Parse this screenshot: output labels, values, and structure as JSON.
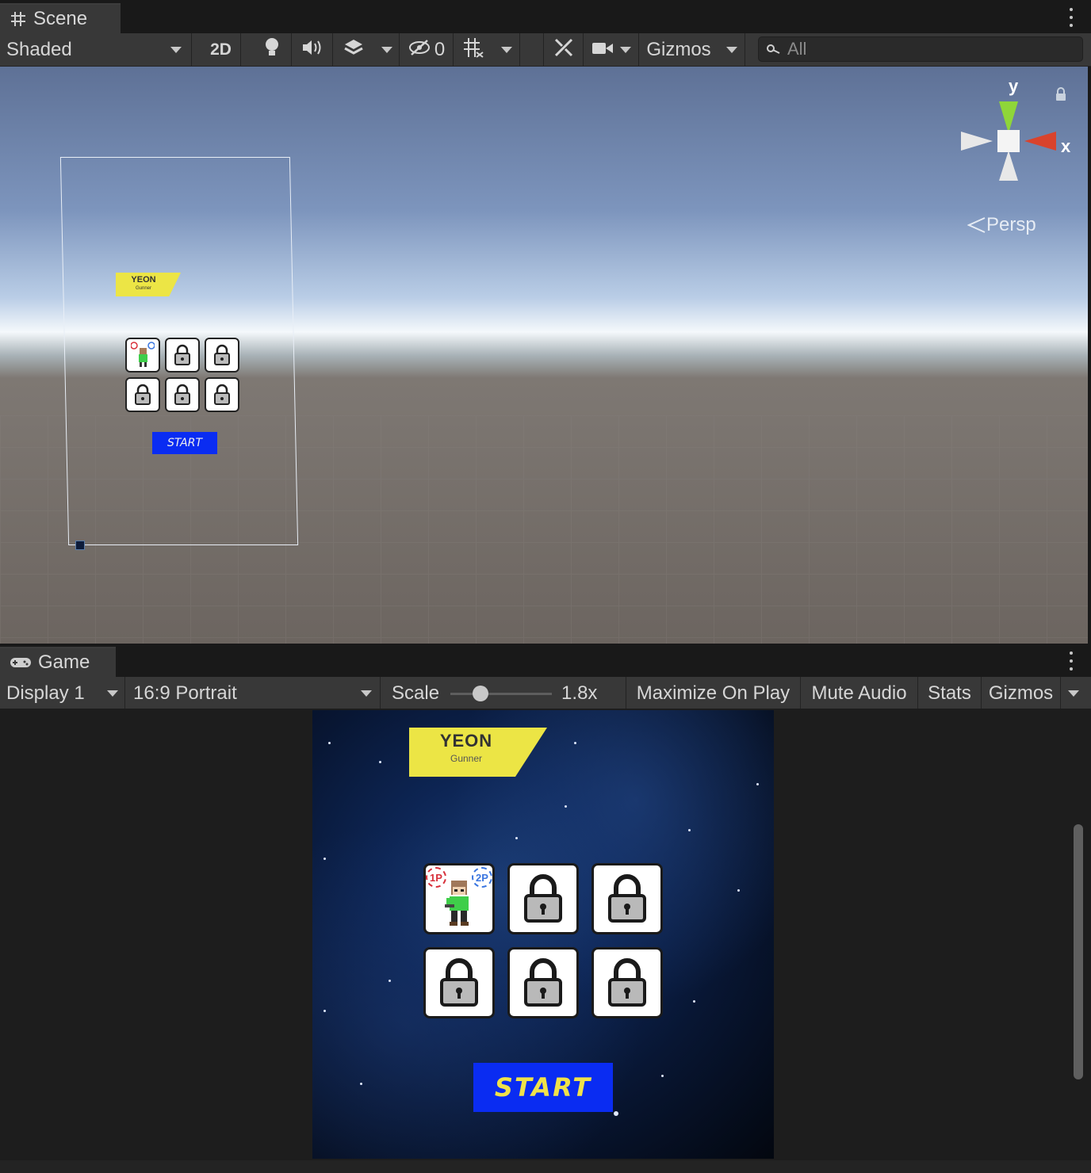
{
  "scene": {
    "tab_label": "Scene",
    "toolbar": {
      "draw_mode": "Shaded",
      "mode_2d": "2D",
      "hidden_count": "0",
      "gizmos_label": "Gizmos",
      "search_placeholder": "All"
    },
    "gizmo": {
      "y_label": "y",
      "x_label": "x",
      "projection": "Persp"
    },
    "preview": {
      "title": "YEON",
      "subtitle": "Gunner",
      "start_label": "START"
    }
  },
  "game": {
    "tab_label": "Game",
    "toolbar": {
      "display": "Display 1",
      "aspect": "16:9 Portrait",
      "scale_label": "Scale",
      "scale_value": "1.8x",
      "maximize_on_play": "Maximize On Play",
      "mute_audio": "Mute Audio",
      "stats": "Stats",
      "gizmos": "Gizmos"
    },
    "screen": {
      "character_name": "YEON",
      "character_class": "Gunner",
      "player1_badge": "1P",
      "player2_badge": "2P",
      "start_label": "START",
      "slots": [
        "character",
        "locked",
        "locked",
        "locked",
        "locked",
        "locked"
      ]
    }
  },
  "colors": {
    "banner": "#ece545",
    "start_button": "#0a2cf2",
    "start_text": "#f0e24a",
    "gizmo_x": "#d9432c",
    "gizmo_y": "#8fd639"
  }
}
